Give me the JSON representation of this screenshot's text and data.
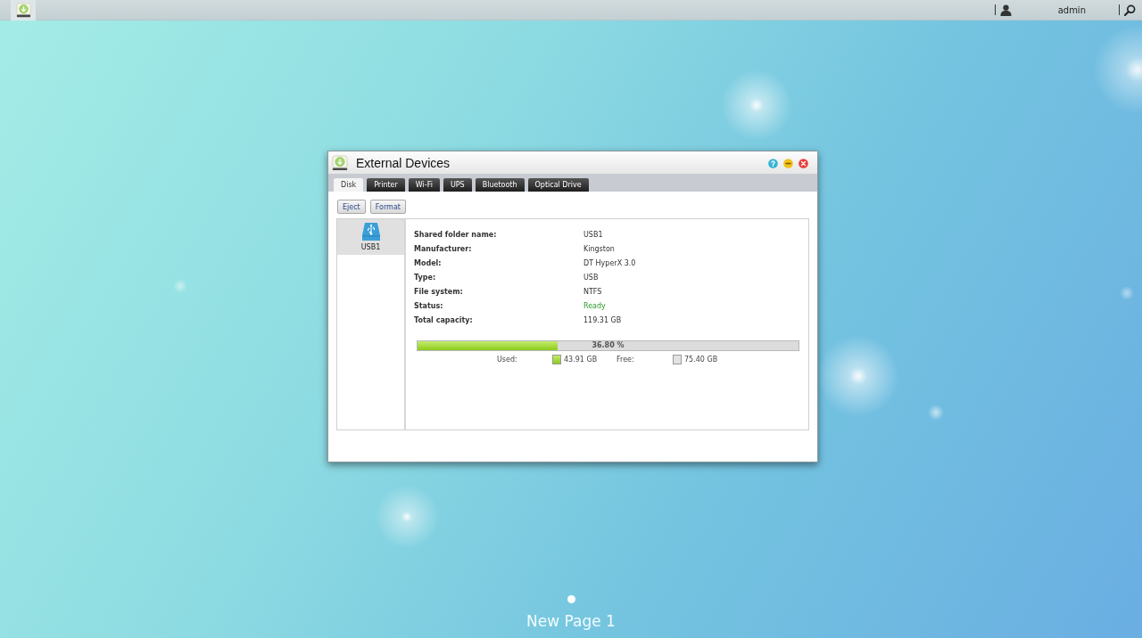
{
  "top_bar": {
    "username": "admin"
  },
  "window": {
    "title": "External Devices"
  },
  "tabs": [
    {
      "label": "Disk",
      "selected": true
    },
    {
      "label": "Printer",
      "selected": false
    },
    {
      "label": "Wi-Fi",
      "selected": false
    },
    {
      "label": "UPS",
      "selected": false
    },
    {
      "label": "Bluetooth",
      "selected": false
    },
    {
      "label": "Optical Drive",
      "selected": false
    }
  ],
  "toolbar": [
    "Eject",
    "Format"
  ],
  "devices": [
    {
      "label": "USB1",
      "selected": true
    }
  ],
  "details": [
    {
      "label": "Shared folder name:",
      "value": "USB1",
      "kind": "text"
    },
    {
      "label": "Manufacturer:",
      "value": "Kingston",
      "kind": "text"
    },
    {
      "label": "Model:",
      "value": "DT HyperX 3.0",
      "kind": "text"
    },
    {
      "label": "Type:",
      "value": "USB",
      "kind": "text"
    },
    {
      "label": "File system:",
      "value": "NTFS",
      "kind": "text"
    },
    {
      "label": "Status:",
      "value": "Ready",
      "kind": "status"
    },
    {
      "label": "Total capacity:",
      "value": "119.31 GB",
      "kind": "text"
    }
  ],
  "usage": {
    "level": 0.368,
    "percent": "36.80 %",
    "used_label": "Used:",
    "used": "43.91 GB",
    "free_label": "Free:",
    "free": "75.40 GB"
  },
  "pages": [
    {
      "selected": true
    }
  ],
  "page_title": "New Page 1"
}
